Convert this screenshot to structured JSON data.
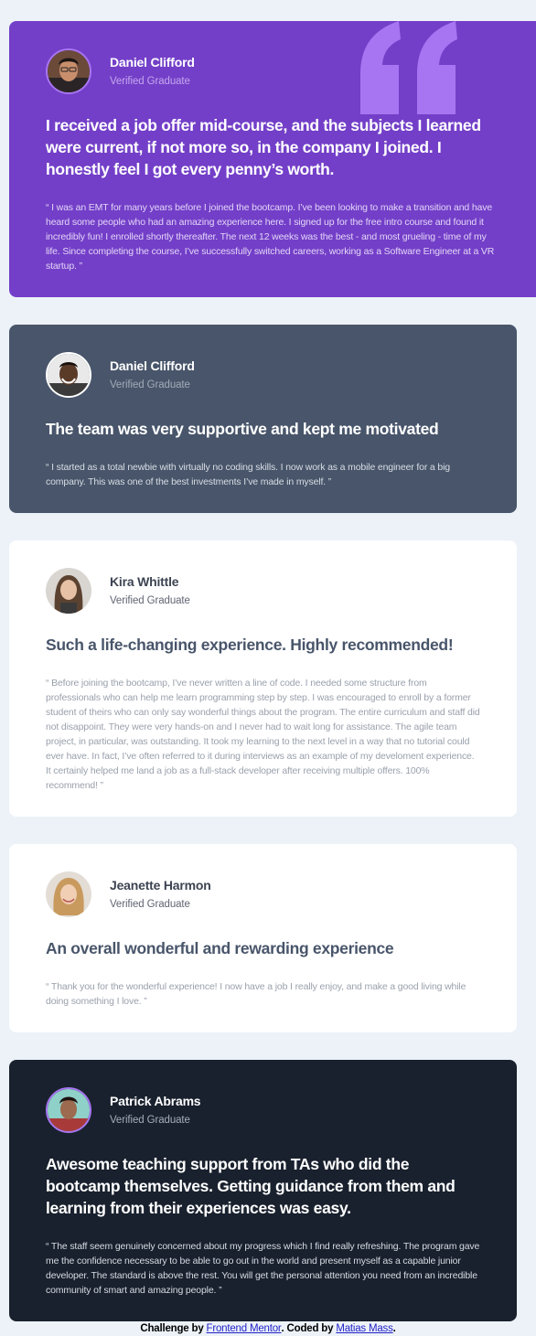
{
  "colors": {
    "page_background": "#ecf2f8",
    "violet": "#733fc8",
    "slate": "#48556a",
    "white": "#ffffff",
    "dark": "#19212e",
    "quote_mark": "#a775f1",
    "link": "#2323c8"
  },
  "testimonials": [
    {
      "theme": "violet",
      "avatar_icon": "avatar-photo-daniel",
      "name": "Daniel Clifford",
      "role": "Verified Graduate",
      "headline": "I received a job offer mid-course, and the subjects I learned were current, if not more so, in the company I joined. I honestly feel I got every penny’s worth.",
      "body": "“ I was an EMT for many years before I joined the bootcamp. I’ve been looking to make a transition and have heard some people who had an amazing experience here. I signed up for the free intro course and found it incredibly fun! I enrolled shortly thereafter. The next 12 weeks was the best - and most grueling - time of my life. Since completing the course, I’ve successfully switched careers, working as a Software Engineer at a VR startup. ”"
    },
    {
      "theme": "slate",
      "avatar_icon": "avatar-photo-jonathan",
      "name": "Daniel Clifford",
      "role": "Verified Graduate",
      "headline": "The team was very supportive and kept me motivated",
      "body": "“ I started as a total newbie with virtually no coding skills. I now work as a mobile engineer for a big company. This was one of the best investments I’ve made in myself. ”"
    },
    {
      "theme": "white",
      "avatar_icon": "avatar-photo-kira",
      "name": "Kira Whittle",
      "role": "Verified Graduate",
      "headline": "Such a life-changing experience. Highly recommended!",
      "body": "“ Before joining the bootcamp, I’ve never written a line of code. I needed some structure from professionals who can help me learn programming step by step. I was encouraged to enroll by a former student of theirs who can only say wonderful things about the program. The entire curriculum and staff did not disappoint. They were very hands-on and I never had to wait long for assistance. The agile team project, in particular, was outstanding. It took my learning to the next level in a way that no tutorial could ever have. In fact, I’ve often referred to it during interviews as an example of my develoment experience. It certainly helped me land a job as a full-stack developer after receiving multiple offers. 100% recommend! ”"
    },
    {
      "theme": "white",
      "avatar_icon": "avatar-photo-jeanette",
      "name": "Jeanette Harmon",
      "role": "Verified Graduate",
      "headline": "An overall wonderful and rewarding experience",
      "body": "“ Thank you for the wonderful experience! I now have a job I really enjoy, and make a good living while doing something I love. ”"
    },
    {
      "theme": "dark",
      "avatar_icon": "avatar-photo-patrick",
      "name": "Patrick Abrams",
      "role": "Verified Graduate",
      "headline": "Awesome teaching support from TAs who did the bootcamp themselves. Getting guidance from them and learning from their experiences was easy.",
      "body": "“ The staff seem genuinely concerned about my progress which I find really refreshing. The program gave me the confidence necessary to be able to go out in the world and present myself as a capable junior developer. The standard is above the rest. You will get the personal attention you need from an incredible community of smart and amazing people. ”"
    }
  ],
  "attribution": {
    "prefix": "Challenge by ",
    "challenge_link": "Frontend Mentor",
    "middle": ". Coded by ",
    "author_link": "Matias Mass",
    "suffix": "."
  }
}
